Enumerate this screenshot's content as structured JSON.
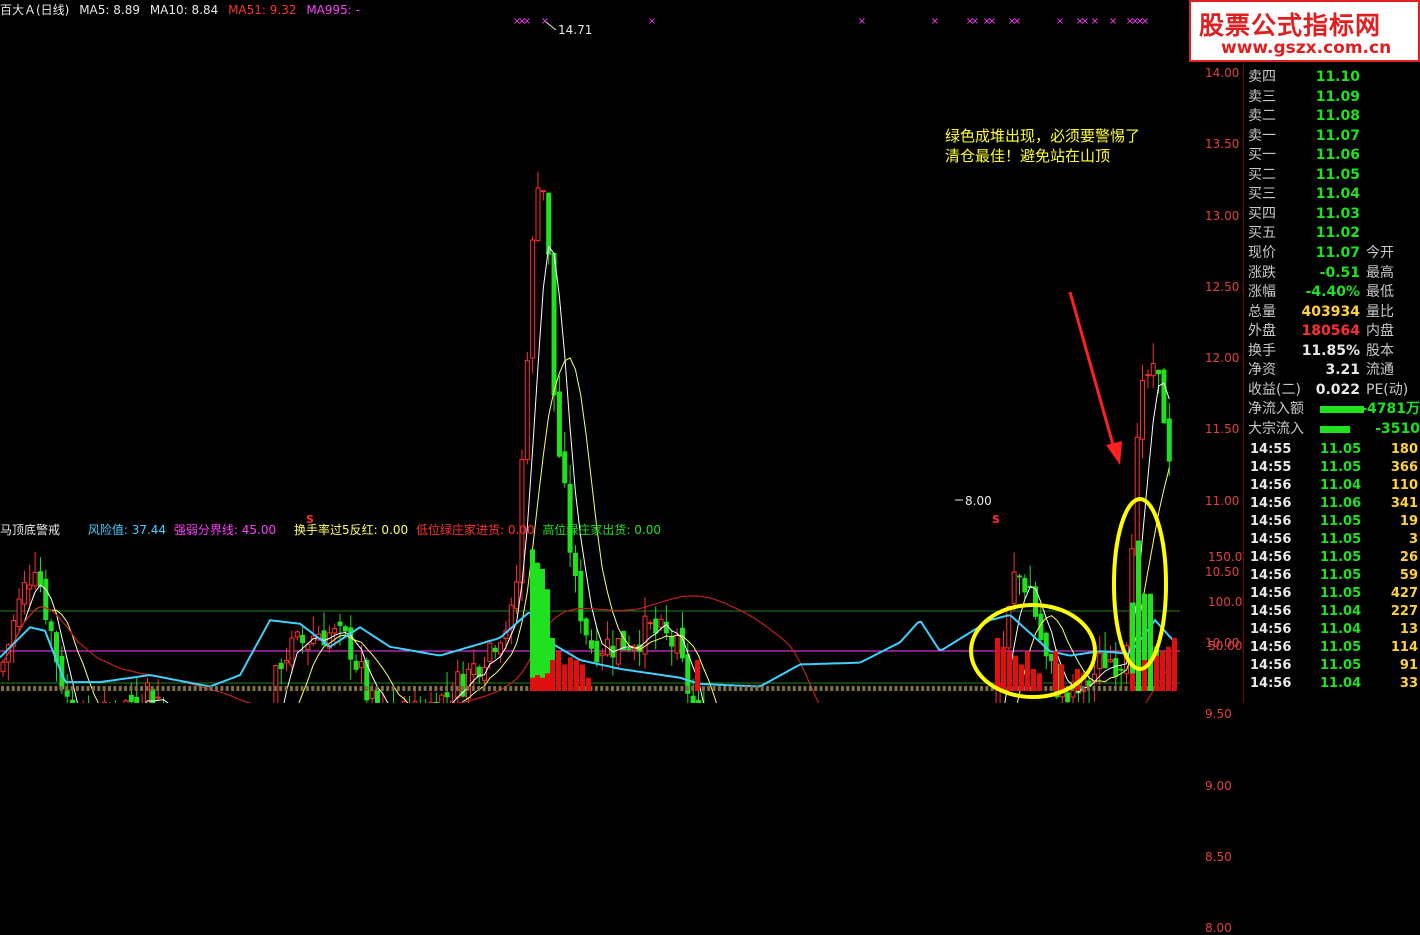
{
  "header": {
    "stock_name": "百大Ａ(日线)",
    "ma5_label": "MA5: 8.89",
    "ma10_label": "MA10: 8.84",
    "ma51_label": "MA51: 9.32",
    "ma995_label": "MA995: -"
  },
  "indicator_header": {
    "name": "马顶底警戒",
    "risk_label": "风险值: 37.44",
    "strength_label": "强弱分界线: 45.00",
    "turnover_label": "换手率过5反红: 0.00",
    "low_accum_label": "低位绿庄家进货: 0.00",
    "high_dist_label": "高位绿庄家出货: 0.00"
  },
  "annotation": {
    "line1": "绿色成堆出现，必须要警惕了",
    "line2": "清仓最佳！避免站在山顶"
  },
  "chart_labels": {
    "high_price": "14.71",
    "low_price": "8.00",
    "signal_glyph": "S",
    "top_marker": "×"
  },
  "price_axis": [
    "14.00",
    "13.50",
    "13.00",
    "12.50",
    "12.00",
    "11.50",
    "11.00",
    "10.50",
    "10.00",
    "9.50",
    "9.00",
    "8.50",
    "8.00"
  ],
  "indicator_axis": [
    "150.0",
    "100.0",
    "50.00"
  ],
  "logo": {
    "title": "股票公式指标网",
    "url": "www.gszx.com.cn"
  },
  "order_book": [
    {
      "label": "卖四",
      "value": "11.10"
    },
    {
      "label": "卖三",
      "value": "11.09"
    },
    {
      "label": "卖二",
      "value": "11.08"
    },
    {
      "label": "卖一",
      "value": "11.07"
    },
    {
      "label": "买一",
      "value": "11.06"
    },
    {
      "label": "买二",
      "value": "11.05"
    },
    {
      "label": "买三",
      "value": "11.04"
    },
    {
      "label": "买四",
      "value": "11.03"
    },
    {
      "label": "买五",
      "value": "11.02"
    }
  ],
  "quote": [
    {
      "label": "现价",
      "value": "11.07",
      "label2": "今开",
      "color": "green"
    },
    {
      "label": "涨跌",
      "value": "-0.51",
      "label2": "最高",
      "color": "green"
    },
    {
      "label": "涨幅",
      "value": "-4.40%",
      "label2": "最低",
      "color": "green"
    },
    {
      "label": "总量",
      "value": "403934",
      "label2": "量比",
      "color": "yellow"
    },
    {
      "label": "外盘",
      "value": "180564",
      "label2": "内盘",
      "color": "red"
    },
    {
      "label": "换手",
      "value": "11.85%",
      "label2": "股本",
      "color": "white"
    },
    {
      "label": "净资",
      "value": "3.21",
      "label2": "流通",
      "color": "white"
    },
    {
      "label": "收益(二)",
      "value": "0.022",
      "label2": "PE(动)",
      "color": "white"
    }
  ],
  "flows": [
    {
      "label": "净流入额",
      "value": "-4781万"
    },
    {
      "label": "大宗流入",
      "value": "-3510"
    }
  ],
  "ticks": [
    {
      "time": "14:55",
      "price": "11.05",
      "vol": "180"
    },
    {
      "time": "14:55",
      "price": "11.05",
      "vol": "366"
    },
    {
      "time": "14:56",
      "price": "11.04",
      "vol": "110"
    },
    {
      "time": "14:56",
      "price": "11.06",
      "vol": "341"
    },
    {
      "time": "14:56",
      "price": "11.05",
      "vol": "19"
    },
    {
      "time": "14:56",
      "price": "11.05",
      "vol": "3"
    },
    {
      "time": "14:56",
      "price": "11.05",
      "vol": "26"
    },
    {
      "time": "14:56",
      "price": "11.05",
      "vol": "59"
    },
    {
      "time": "14:56",
      "price": "11.05",
      "vol": "427"
    },
    {
      "time": "14:56",
      "price": "11.04",
      "vol": "227"
    },
    {
      "time": "14:56",
      "price": "11.04",
      "vol": "13"
    },
    {
      "time": "14:56",
      "price": "11.05",
      "vol": "114"
    },
    {
      "time": "14:56",
      "price": "11.05",
      "vol": "91"
    },
    {
      "time": "14:56",
      "price": "11.04",
      "vol": "33"
    }
  ],
  "colors": {
    "up": "#ff3030",
    "down": "#20e020",
    "ma5": "#ffffff",
    "ma10": "#ffff66",
    "ma51": "#c02020",
    "risk": "#40d0ff",
    "strength": "#ff40ff",
    "highlight": "#ffff00",
    "arrow": "#ff2020"
  }
}
